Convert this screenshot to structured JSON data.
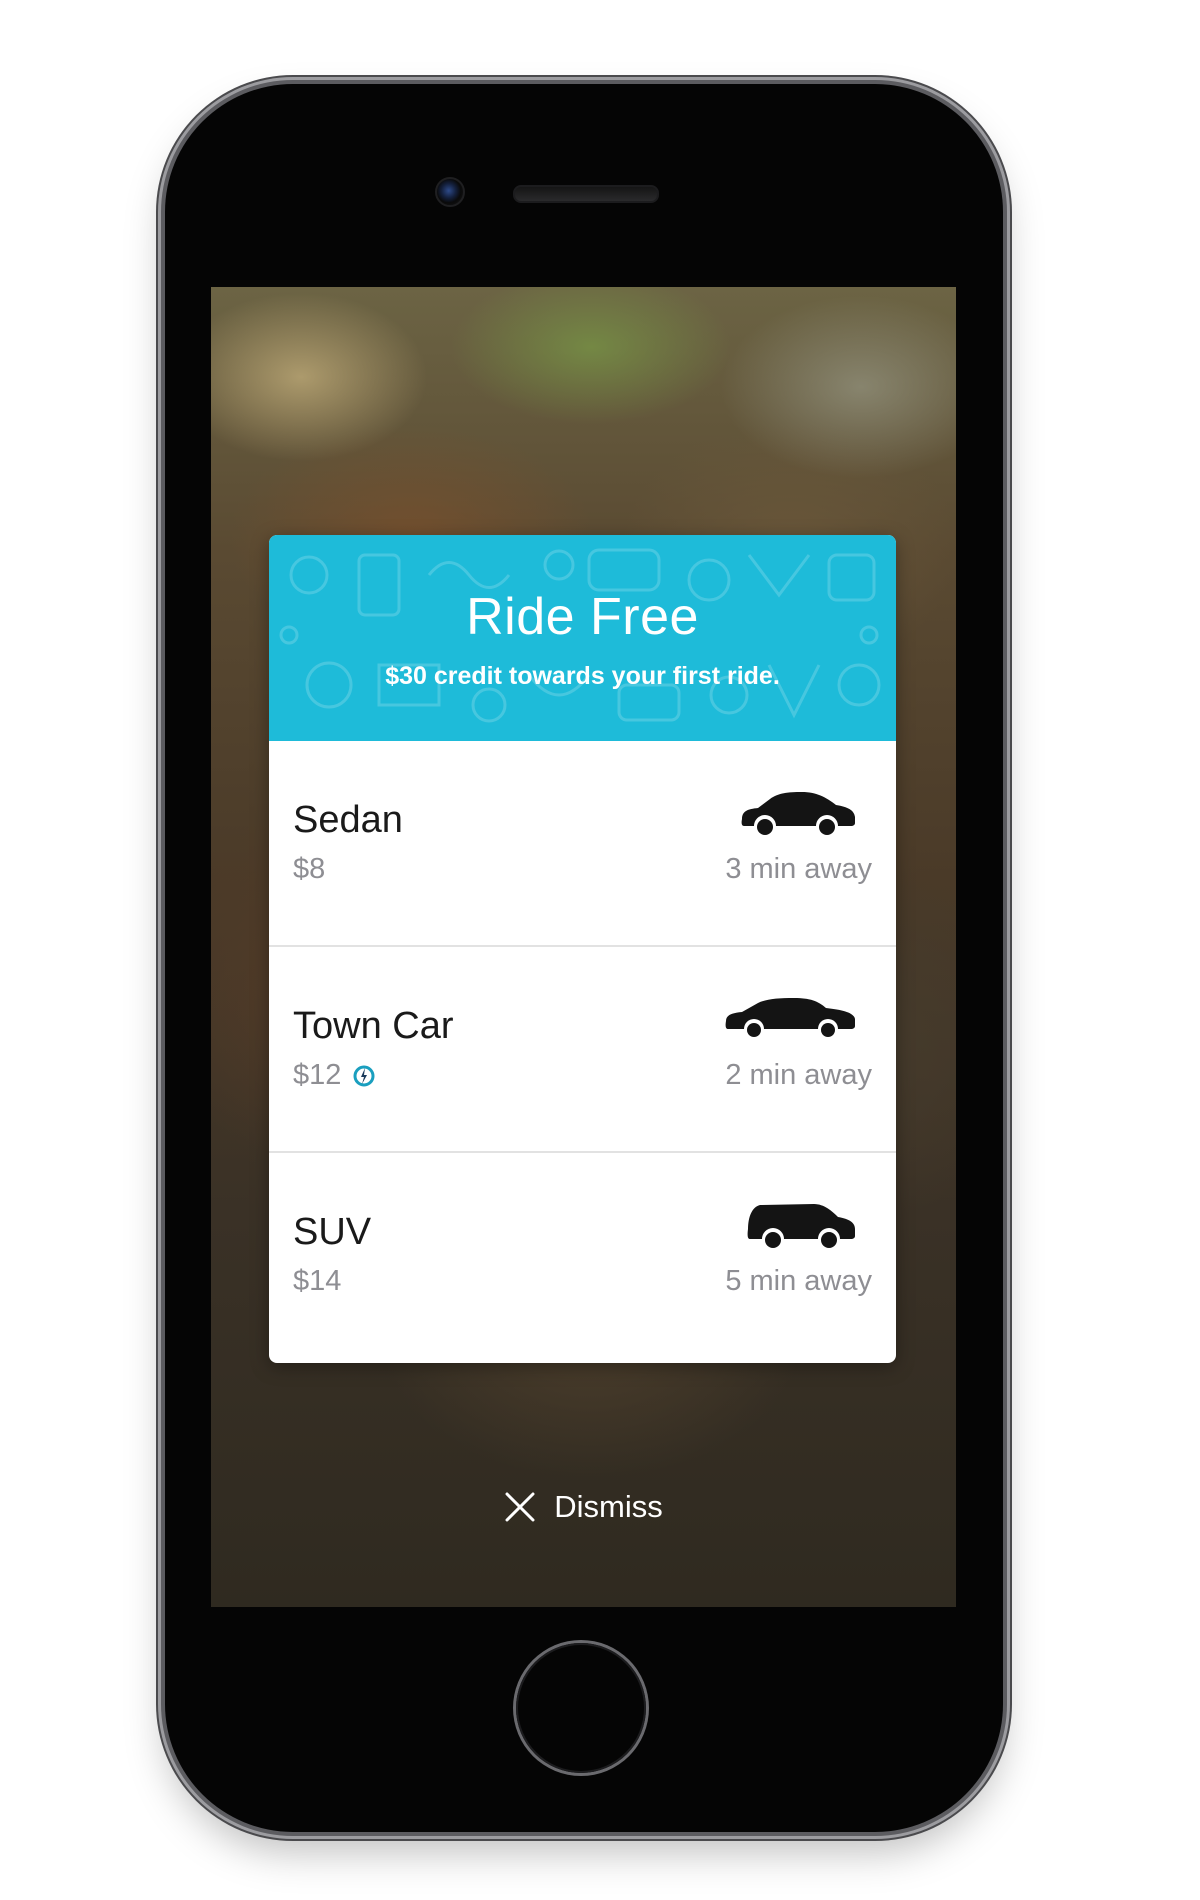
{
  "promo": {
    "title": "Ride Free",
    "subtitle": "$30 credit towards your first ride."
  },
  "rides": [
    {
      "name": "Sedan",
      "price": "$8",
      "eta": "3 min away",
      "icon": "sedan-car-icon",
      "surge": false
    },
    {
      "name": "Town Car",
      "price": "$12",
      "eta": "2 min away",
      "icon": "town-car-icon",
      "surge": true
    },
    {
      "name": "SUV",
      "price": "$14",
      "eta": "5 min away",
      "icon": "suv-car-icon",
      "surge": false
    }
  ],
  "dismiss": {
    "label": "Dismiss",
    "icon": "close-icon"
  },
  "colors": {
    "accent": "#1ebbd9",
    "text_primary": "#1a1a1a",
    "text_secondary": "#8e8e93",
    "surge_icon": "#1a9fbf"
  }
}
